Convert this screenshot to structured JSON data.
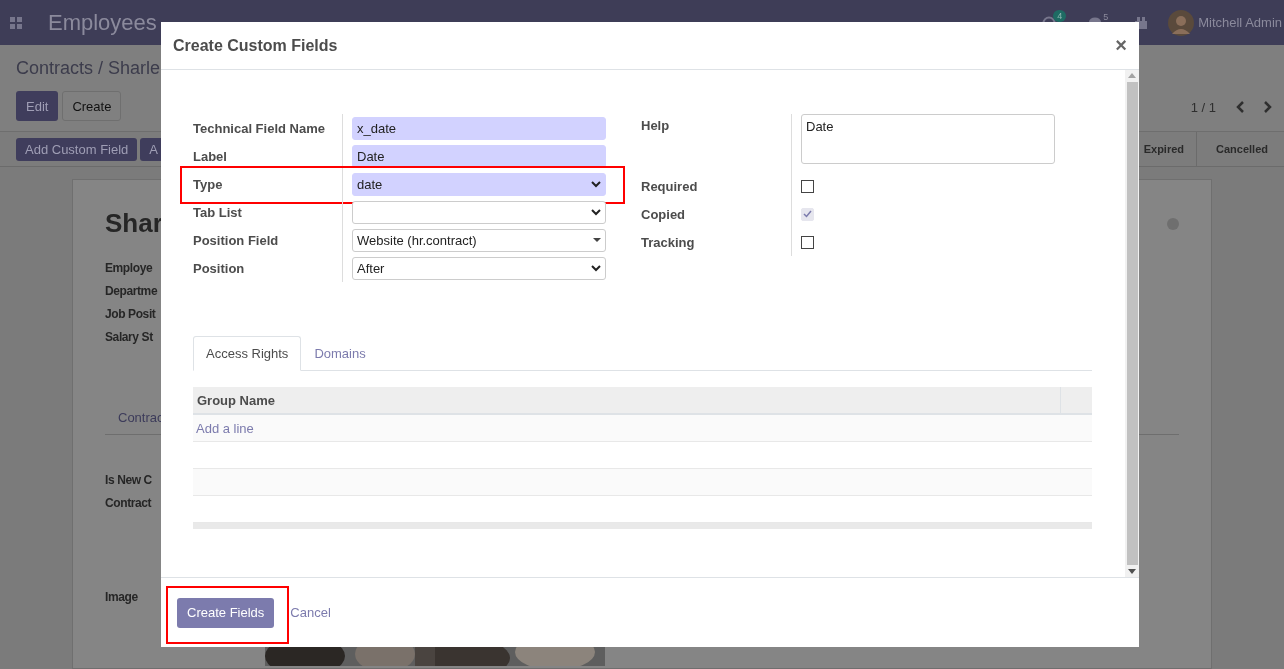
{
  "navbar": {
    "app": "Employees",
    "activity_count": "4",
    "message_count": "5",
    "user": "Mitchell Admin"
  },
  "breadcrumb": "Contracts / Sharle",
  "actions": [
    "Edit",
    "Create"
  ],
  "pager": "1 / 1",
  "header_buttons": [
    "Add Custom Field",
    "A"
  ],
  "stages": [
    {
      "label": "Expired",
      "selected": false
    },
    {
      "label": "Cancelled",
      "selected": false
    }
  ],
  "sheet": {
    "title": "Shar",
    "fields": [
      "Employe",
      "Departme",
      "Job Posit",
      "Salary St"
    ],
    "tab": "Contrac",
    "fields_2": [
      "Is New C",
      "Contract"
    ],
    "image_label": "Image"
  },
  "dialog": {
    "title": "Create Custom Fields",
    "close": "×",
    "left_fields": [
      {
        "label": "Technical Field Name",
        "kind": "text",
        "value": "x_date",
        "required": true,
        "highlighted": false
      },
      {
        "label": "Label",
        "kind": "text",
        "value": "Date",
        "required": true,
        "highlighted": false
      },
      {
        "label": "Type",
        "kind": "select",
        "value": "date",
        "required": true,
        "highlighted": true
      },
      {
        "label": "Tab List",
        "kind": "select",
        "required": false,
        "highlighted": false
      },
      {
        "label": "Position Field",
        "kind": "combo",
        "value": "Website (hr.contract)",
        "required": false,
        "highlighted": false
      },
      {
        "label": "Position",
        "kind": "select",
        "value": "After",
        "required": false,
        "highlighted": false
      }
    ],
    "right_fields": [
      {
        "label": "Help",
        "kind": "textarea",
        "value": "Date"
      },
      {
        "label": "Required",
        "kind": "checkbox",
        "checked": false,
        "disabled": false
      },
      {
        "label": "Copied",
        "kind": "checkbox",
        "checked": true,
        "disabled": true
      },
      {
        "label": "Tracking",
        "kind": "checkbox",
        "checked": false,
        "disabled": false
      }
    ],
    "tabs": [
      {
        "label": "Access Rights",
        "selected": true
      },
      {
        "label": "Domains",
        "selected": false
      }
    ],
    "table": {
      "columns": [
        "Group Name"
      ],
      "add_line": "Add a line"
    },
    "footer": {
      "primary": {
        "label": "Create Fields",
        "highlighted": true
      },
      "cancel": "Cancel"
    }
  }
}
